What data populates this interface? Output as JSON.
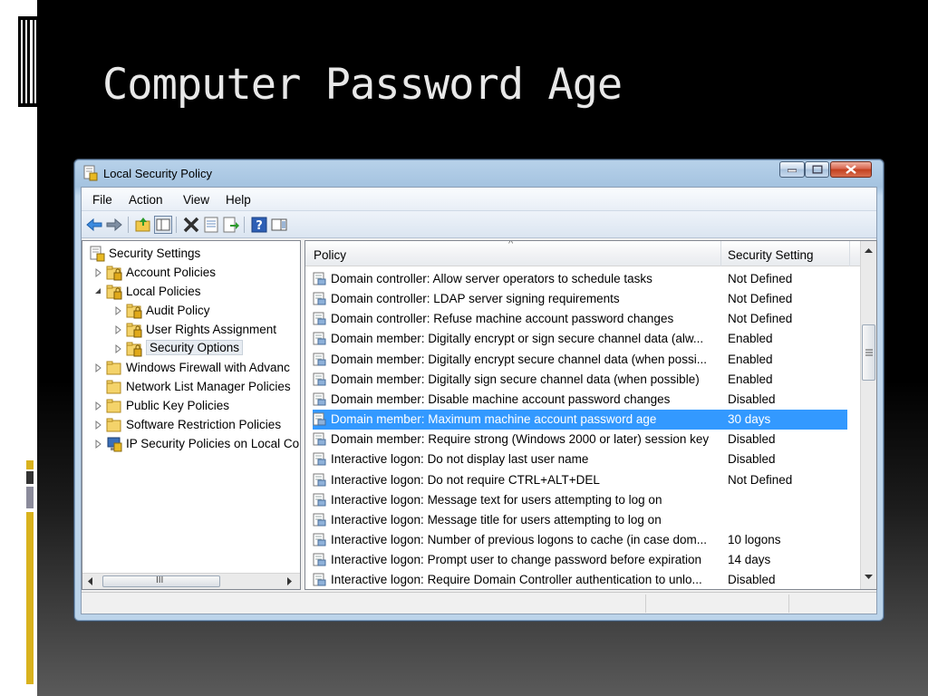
{
  "slide": {
    "title": "Computer Password Age",
    "accent_colors": {
      "yellow": "#d9b21d",
      "gray": "#8b8b9b"
    }
  },
  "window": {
    "title": "Local Security Policy",
    "title_icon": "security-policy-icon",
    "controls": [
      "minimize-icon",
      "maximize-icon",
      "close-icon"
    ]
  },
  "menu": {
    "items": [
      {
        "label": "File"
      },
      {
        "label": "Action"
      },
      {
        "label": "View"
      },
      {
        "label": "Help"
      }
    ]
  },
  "toolbar": {
    "buttons": [
      "back-icon",
      "forward-icon",
      "up-folder-icon",
      "show-hide-tree-icon",
      "delete-icon",
      "properties-icon",
      "export-list-icon",
      "help-icon",
      "show-hide-action-pane-icon"
    ]
  },
  "tree": {
    "items": [
      {
        "label": "Security Settings",
        "icon": "security-settings-icon",
        "level": 0,
        "expander": "none"
      },
      {
        "label": "Account Policies",
        "icon": "locked-folder-icon",
        "level": 1,
        "expander": "collapsed"
      },
      {
        "label": "Local Policies",
        "icon": "locked-folder-icon",
        "level": 1,
        "expander": "expanded"
      },
      {
        "label": "Audit Policy",
        "icon": "locked-folder-icon",
        "level": 2,
        "expander": "collapsed"
      },
      {
        "label": "User Rights Assignment",
        "icon": "locked-folder-icon",
        "level": 2,
        "expander": "collapsed"
      },
      {
        "label": "Security Options",
        "icon": "locked-folder-icon",
        "level": 2,
        "expander": "collapsed",
        "selected": true
      },
      {
        "label": "Windows Firewall with Advanc",
        "icon": "folder-icon",
        "level": 1,
        "expander": "collapsed"
      },
      {
        "label": "Network List Manager Policies",
        "icon": "folder-icon",
        "level": 1,
        "expander": "none"
      },
      {
        "label": "Public Key Policies",
        "icon": "folder-icon",
        "level": 1,
        "expander": "collapsed"
      },
      {
        "label": "Software Restriction Policies",
        "icon": "folder-icon",
        "level": 1,
        "expander": "collapsed"
      },
      {
        "label": "IP Security Policies on Local Co",
        "icon": "ip-security-icon",
        "level": 1,
        "expander": "collapsed"
      }
    ],
    "hscroll_thumb_glyph": "III"
  },
  "list": {
    "columns": {
      "policy": "Policy",
      "setting": "Security Setting"
    },
    "sort_glyph": "^",
    "rows": [
      {
        "policy": "Domain controller: Allow server operators to schedule tasks",
        "setting": "Not Defined"
      },
      {
        "policy": "Domain controller: LDAP server signing requirements",
        "setting": "Not Defined"
      },
      {
        "policy": "Domain controller: Refuse machine account password changes",
        "setting": "Not Defined"
      },
      {
        "policy": "Domain member: Digitally encrypt or sign secure channel data (alw...",
        "setting": "Enabled"
      },
      {
        "policy": "Domain member: Digitally encrypt secure channel data (when possi...",
        "setting": "Enabled"
      },
      {
        "policy": "Domain member: Digitally sign secure channel data (when possible)",
        "setting": "Enabled"
      },
      {
        "policy": "Domain member: Disable machine account password changes",
        "setting": "Disabled"
      },
      {
        "policy": "Domain member: Maximum machine account password age",
        "setting": "30 days",
        "selected": true
      },
      {
        "policy": "Domain member: Require strong (Windows 2000 or later) session key",
        "setting": "Disabled"
      },
      {
        "policy": "Interactive logon: Do not display last user name",
        "setting": "Disabled"
      },
      {
        "policy": "Interactive logon: Do not require CTRL+ALT+DEL",
        "setting": "Not Defined"
      },
      {
        "policy": "Interactive logon: Message text for users attempting to log on",
        "setting": ""
      },
      {
        "policy": "Interactive logon: Message title for users attempting to log on",
        "setting": ""
      },
      {
        "policy": "Interactive logon: Number of previous logons to cache (in case dom...",
        "setting": "10 logons"
      },
      {
        "policy": "Interactive logon: Prompt user to change password before expiration",
        "setting": "14 days"
      },
      {
        "policy": "Interactive logon: Require Domain Controller authentication to unlo...",
        "setting": "Disabled"
      }
    ],
    "selected_color": "#3399ff"
  }
}
